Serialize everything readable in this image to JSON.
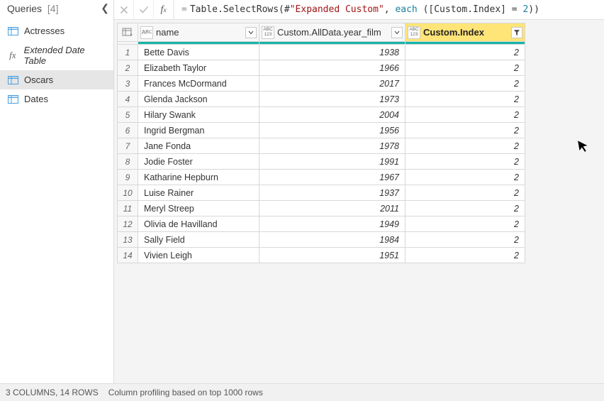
{
  "sidebar": {
    "title": "Queries",
    "count": "[4]",
    "items": [
      {
        "label": "Actresses",
        "icon": "table"
      },
      {
        "label": "Extended Date Table",
        "icon": "fx"
      },
      {
        "label": "Oscars",
        "icon": "table",
        "selected": true
      },
      {
        "label": "Dates",
        "icon": "table"
      }
    ]
  },
  "formula": {
    "prefix": "=",
    "fn": "Table.SelectRows",
    "arg_str": "\"Expanded Custom\"",
    "each": "each",
    "field": "[Custom.Index]",
    "value": "2"
  },
  "columns": [
    {
      "key": "name",
      "label": "name",
      "type": "text",
      "width": "col-name"
    },
    {
      "key": "year",
      "label": "Custom.AllData.year_film",
      "type": "any",
      "width": "col-year"
    },
    {
      "key": "index",
      "label": "Custom.Index",
      "type": "any",
      "width": "col-index",
      "selected": true,
      "filtered": true
    }
  ],
  "rows": [
    {
      "n": "1",
      "name": "Bette Davis",
      "year": "1938",
      "index": "2"
    },
    {
      "n": "2",
      "name": "Elizabeth Taylor",
      "year": "1966",
      "index": "2"
    },
    {
      "n": "3",
      "name": "Frances McDormand",
      "year": "2017",
      "index": "2"
    },
    {
      "n": "4",
      "name": "Glenda Jackson",
      "year": "1973",
      "index": "2"
    },
    {
      "n": "5",
      "name": "Hilary Swank",
      "year": "2004",
      "index": "2"
    },
    {
      "n": "6",
      "name": "Ingrid Bergman",
      "year": "1956",
      "index": "2"
    },
    {
      "n": "7",
      "name": "Jane Fonda",
      "year": "1978",
      "index": "2"
    },
    {
      "n": "8",
      "name": "Jodie Foster",
      "year": "1991",
      "index": "2"
    },
    {
      "n": "9",
      "name": "Katharine Hepburn",
      "year": "1967",
      "index": "2"
    },
    {
      "n": "10",
      "name": "Luise Rainer",
      "year": "1937",
      "index": "2"
    },
    {
      "n": "11",
      "name": "Meryl Streep",
      "year": "2011",
      "index": "2"
    },
    {
      "n": "12",
      "name": "Olivia de Havilland",
      "year": "1949",
      "index": "2"
    },
    {
      "n": "13",
      "name": "Sally Field",
      "year": "1984",
      "index": "2"
    },
    {
      "n": "14",
      "name": "Vivien Leigh",
      "year": "1951",
      "index": "2"
    }
  ],
  "status": {
    "columns_rows": "3 COLUMNS, 14 ROWS",
    "profiling": "Column profiling based on top 1000 rows"
  }
}
